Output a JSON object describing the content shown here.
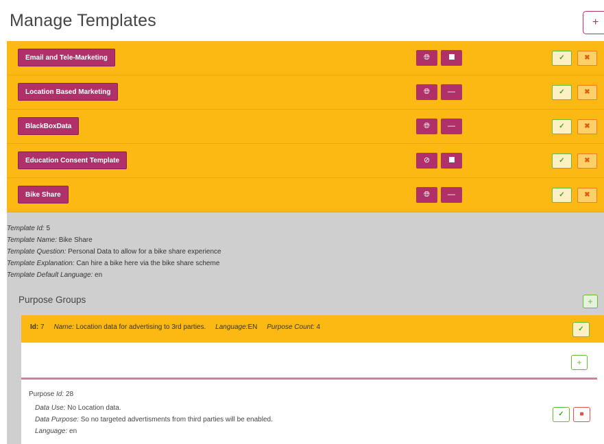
{
  "header": {
    "title": "Manage Templates",
    "add_label": "+"
  },
  "templates": [
    {
      "name": "Email and Tele-Marketing",
      "lang_icon": "globe-icon",
      "state_icon": "stop-icon",
      "state_glyph": "square"
    },
    {
      "name": "Location Based Marketing",
      "lang_icon": "globe-icon",
      "state_icon": "minus-icon",
      "state_glyph": "—"
    },
    {
      "name": "BlackBoxData",
      "lang_icon": "globe-icon",
      "state_icon": "minus-icon",
      "state_glyph": "—"
    },
    {
      "name": "Education Consent Template",
      "lang_icon": "ban-icon",
      "state_icon": "stop-icon",
      "state_glyph": "square"
    },
    {
      "name": "Bike Share",
      "lang_icon": "globe-icon",
      "state_icon": "minus-icon",
      "state_glyph": "—"
    }
  ],
  "row_buttons": {
    "edit_glyph": "✓",
    "delete_glyph": "✖"
  },
  "details": {
    "id_label": "Template Id:",
    "id_value": " 5",
    "name_label": "Template Name:",
    "name_value": " Bike Share",
    "question_label": "Template Question:",
    "question_value": " Personal Data to allow for a bike share experience",
    "explanation_label": "Template Explanation:",
    "explanation_value": " Can hire a bike here via the bike share scheme",
    "language_label": "Template Default Language:",
    "language_value": " en"
  },
  "purpose_groups": {
    "title": "Purpose Groups",
    "add_label": "+",
    "group": {
      "id_label": "Id:",
      "id_value": " 7",
      "name_label": "Name:",
      "name_value": " Location data for advertising to 3rd parties.",
      "language_label": "Language:",
      "language_value": "EN",
      "count_label": "Purpose Count:",
      "count_value": " 4",
      "edit_glyph": "✓"
    },
    "purpose": {
      "add_label": "+",
      "id_prefix": "Purpose ",
      "id_label": "Id:",
      "id_value": " 28",
      "use_label": "Data Use:",
      "use_value": " No Location data.",
      "purpose_label": "Data Purpose:",
      "purpose_value": " So no targeted advertisments from third parties will be enabled.",
      "language_label": "Language:",
      "language_value": " en",
      "edit_glyph": "✓",
      "delete_glyph": "■"
    }
  },
  "colors": {
    "accent": "#b0306a",
    "row_bg": "#fdb913",
    "panel_bg": "#cfcfcf",
    "success": "#6db33f",
    "warning": "#f47a20",
    "danger": "#d9534f"
  }
}
